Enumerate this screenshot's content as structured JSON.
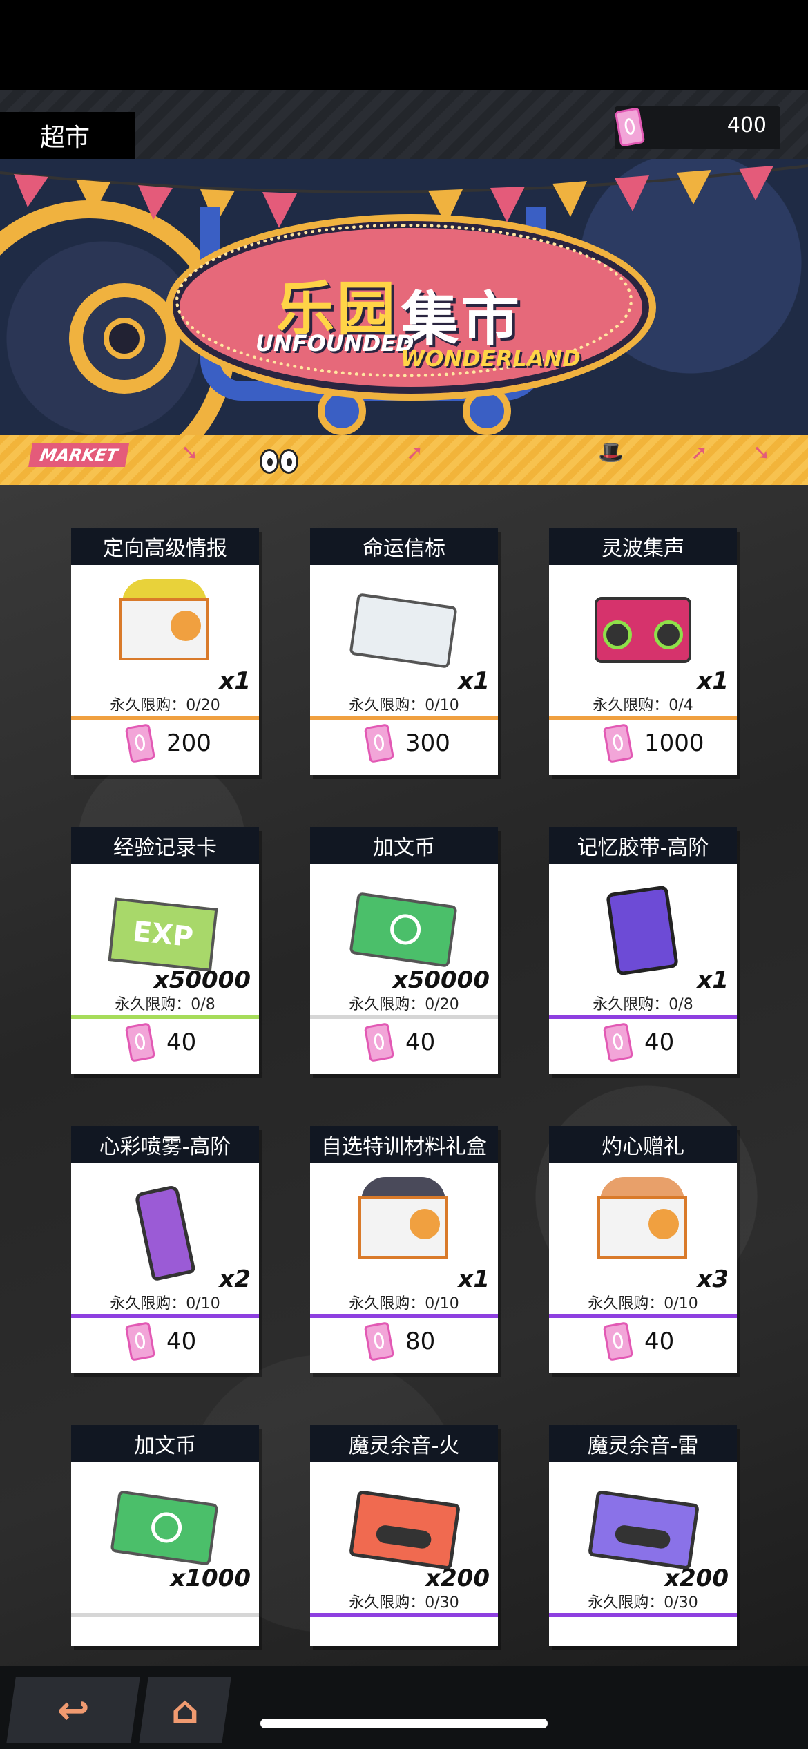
{
  "header": {
    "title": "超市",
    "currency_value": "400",
    "currency_icon": "ticket-icon"
  },
  "banner": {
    "title_a": "乐园",
    "title_b": "集市",
    "subtitle_a": "UNFOUNDED",
    "subtitle_b": "WONDERLAND",
    "tag": "MARKET",
    "colors": {
      "sign": "#e6697a",
      "gold": "#f0b23f",
      "cart": "#3a5fc4"
    }
  },
  "items": [
    {
      "name": "定向高级情报",
      "qty": "x1",
      "limit": "永久限购：0/20",
      "price": "200",
      "rarity_color": "#f0a040",
      "art": "box-gold"
    },
    {
      "name": "命运信标",
      "qty": "x1",
      "limit": "永久限购：0/10",
      "price": "300",
      "rarity_color": "#f0a040",
      "art": "id-card"
    },
    {
      "name": "灵波集声",
      "qty": "x1",
      "limit": "永久限购：0/4",
      "price": "1000",
      "rarity_color": "#f0a040",
      "art": "boombox"
    },
    {
      "name": "经验记录卡",
      "qty": "x50000",
      "limit": "永久限购：0/8",
      "price": "40",
      "rarity_color": "#a6dc5a",
      "art": "exp-card"
    },
    {
      "name": "加文币",
      "qty": "x50000",
      "limit": "永久限购：0/20",
      "price": "40",
      "rarity_color": "#d6d6d6",
      "art": "coin-ticket"
    },
    {
      "name": "记忆胶带-高阶",
      "qty": "x1",
      "limit": "永久限购：0/8",
      "price": "40",
      "rarity_color": "#8e3fe0",
      "art": "film"
    },
    {
      "name": "心彩喷雾-高阶",
      "qty": "x2",
      "limit": "永久限购：0/10",
      "price": "40",
      "rarity_color": "#8e3fe0",
      "art": "spray"
    },
    {
      "name": "自选特训材料礼盒",
      "qty": "x1",
      "limit": "永久限购：0/10",
      "price": "80",
      "rarity_color": "#8e3fe0",
      "art": "box-mixed"
    },
    {
      "name": "灼心赠礼",
      "qty": "x3",
      "limit": "永久限购：0/10",
      "price": "40",
      "rarity_color": "#8e3fe0",
      "art": "box-gift"
    },
    {
      "name": "加文币",
      "qty": "x1000",
      "limit": "",
      "price": "",
      "rarity_color": "#d6d6d6",
      "art": "coin-ticket"
    },
    {
      "name": "魔灵余音-火",
      "qty": "x200",
      "limit": "永久限购：0/30",
      "price": "",
      "rarity_color": "#8e3fe0",
      "art": "tape-fire"
    },
    {
      "name": "魔灵余音-雷",
      "qty": "x200",
      "limit": "永久限购：0/30",
      "price": "",
      "rarity_color": "#8e3fe0",
      "art": "tape-thunder"
    }
  ],
  "bottom_nav": {
    "back_icon": "back-arrow-icon",
    "home_icon": "home-icon"
  }
}
